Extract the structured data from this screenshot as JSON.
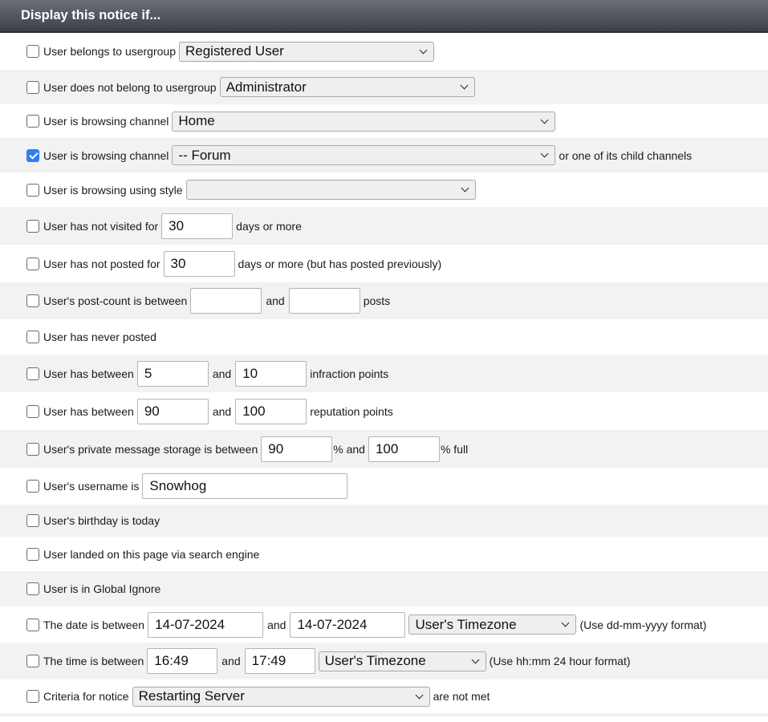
{
  "header": {
    "title": "Display this notice if..."
  },
  "rows": {
    "usergroup": {
      "checked": false,
      "label": "User belongs to usergroup",
      "value": "Registered User"
    },
    "not_usergroup": {
      "checked": false,
      "label": "User does not belong to usergroup",
      "value": "Administrator"
    },
    "channel": {
      "checked": false,
      "label": "User is browsing channel",
      "value": "Home"
    },
    "channel_child": {
      "checked": true,
      "label": "User is browsing channel",
      "value": "-- Forum",
      "suffix": "or one of its child channels"
    },
    "style": {
      "checked": false,
      "label": "User is browsing using style",
      "value": ""
    },
    "not_visited": {
      "checked": false,
      "label": "User has not visited for",
      "value": "30",
      "suffix": "days or more"
    },
    "not_posted": {
      "checked": false,
      "label": "User has not posted for",
      "value": "30",
      "suffix": "days or more (but has posted previously)"
    },
    "postcount": {
      "checked": false,
      "label": "User's post-count is between",
      "min": "",
      "and": "and",
      "max": "",
      "suffix": "posts"
    },
    "never_posted": {
      "checked": false,
      "label": "User has never posted"
    },
    "infraction": {
      "checked": false,
      "label": "User has between",
      "min": "5",
      "and": "and",
      "max": "10",
      "suffix": "infraction points"
    },
    "reputation": {
      "checked": false,
      "label": "User has between",
      "min": "90",
      "and": "and",
      "max": "100",
      "suffix": "reputation points"
    },
    "pm_storage": {
      "checked": false,
      "label": "User's private message storage is between",
      "min": "90",
      "and": "% and",
      "max": "100",
      "suffix": "% full"
    },
    "username": {
      "checked": false,
      "label": "User's username is",
      "value": "Snowhog"
    },
    "birthday": {
      "checked": false,
      "label": "User's birthday is today"
    },
    "search_engine": {
      "checked": false,
      "label": "User landed on this page via search engine"
    },
    "global_ignore": {
      "checked": false,
      "label": "User is in Global Ignore"
    },
    "date": {
      "checked": false,
      "label": "The date is between",
      "min": "14-07-2024",
      "and": "and",
      "max": "14-07-2024",
      "timezone": "User's Timezone",
      "suffix": "(Use dd-mm-yyyy format)"
    },
    "time": {
      "checked": false,
      "label": "The time is between",
      "min": "16:49",
      "and": "and",
      "max": "17:49",
      "timezone": "User's Timezone",
      "suffix": "(Use hh:mm 24 hour format)"
    },
    "criteria": {
      "checked": false,
      "label": "Criteria for notice",
      "value": "Restarting Server",
      "suffix": "are not met"
    }
  },
  "colors": {
    "checkbox_checked": "#2f7ff0",
    "header_top": "#6a6f78",
    "header_bottom": "#3c4048",
    "row_alt": "#f2f2f2"
  }
}
